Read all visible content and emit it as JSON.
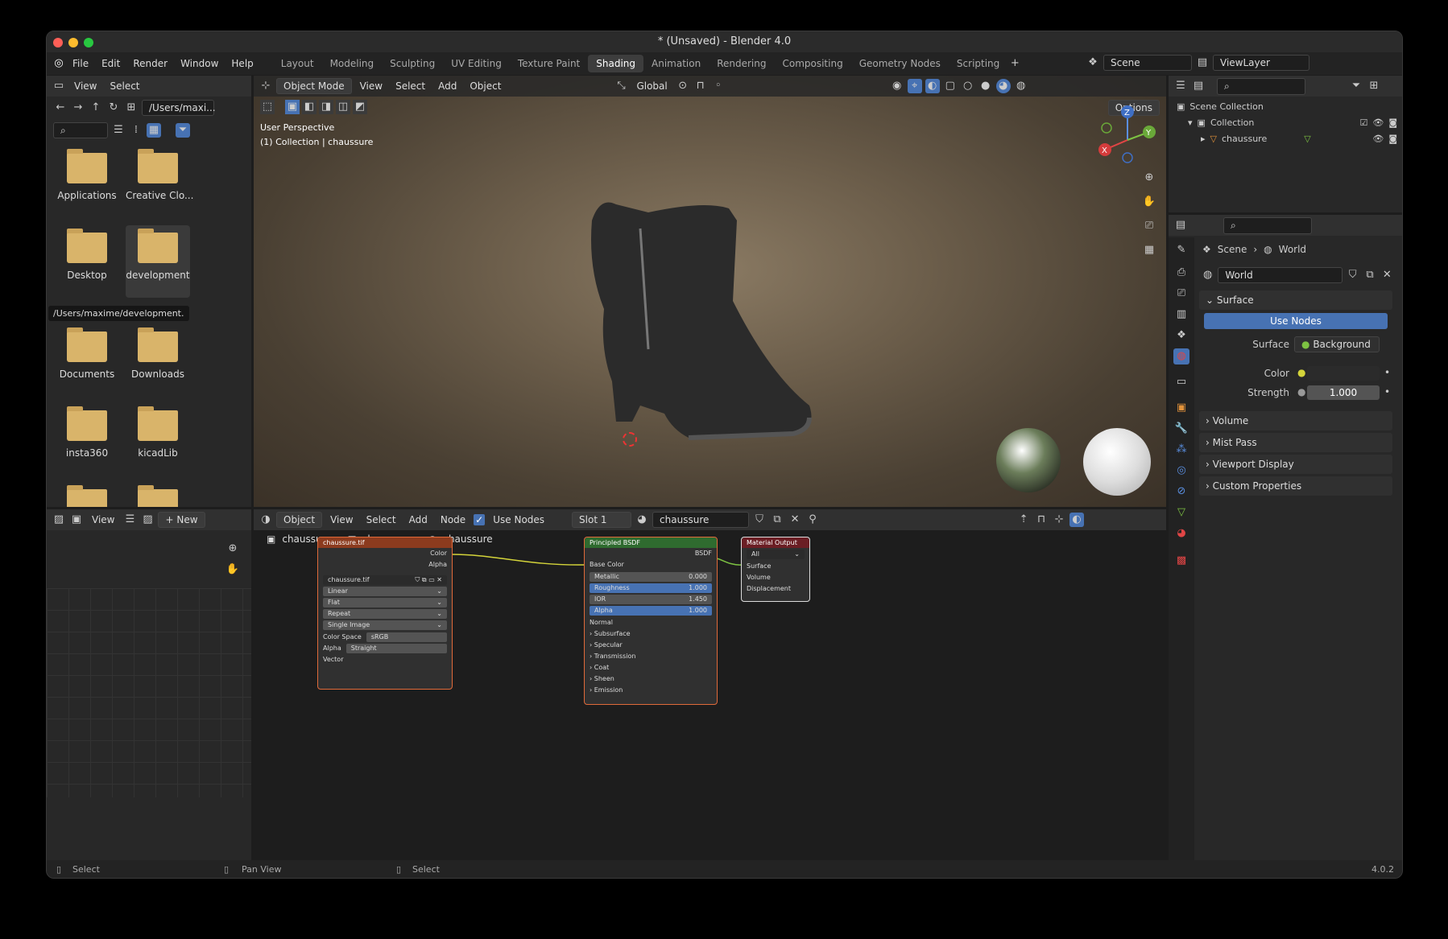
{
  "window": {
    "title": "* (Unsaved) - Blender 4.0"
  },
  "menu": {
    "items": [
      "File",
      "Edit",
      "Render",
      "Window",
      "Help"
    ]
  },
  "workspaces": [
    "Layout",
    "Modeling",
    "Sculpting",
    "UV Editing",
    "Texture Paint",
    "Shading",
    "Animation",
    "Rendering",
    "Compositing",
    "Geometry Nodes",
    "Scripting"
  ],
  "active_workspace": "Shading",
  "scene": {
    "name": "Scene",
    "viewlayer": "ViewLayer"
  },
  "filebrowser": {
    "view": "View",
    "select": "Select",
    "path": "/Users/maxi...",
    "tooltip": "/Users/maxime/development.",
    "folders": [
      "Applications",
      "Creative Clo...",
      "Desktop",
      "development",
      "Documents",
      "Downloads",
      "insta360",
      "kicadLib",
      "",
      ""
    ]
  },
  "viewport": {
    "mode": "Object Mode",
    "menus": [
      "View",
      "Select",
      "Add",
      "Object"
    ],
    "orientation": "Global",
    "options": "Options",
    "perspective": "User Perspective",
    "collection": "(1) Collection | chaussure"
  },
  "outliner": {
    "scene_collection": "Scene Collection",
    "collection": "Collection",
    "object": "chaussure"
  },
  "properties": {
    "breadcrumb_scene": "Scene",
    "breadcrumb_world": "World",
    "world_name": "World",
    "surface_section": "Surface",
    "use_nodes": "Use Nodes",
    "surface_label": "Surface",
    "surface_value": "Background",
    "color_label": "Color",
    "strength_label": "Strength",
    "strength_value": "1.000",
    "sections": [
      "Volume",
      "Mist Pass",
      "Viewport Display",
      "Custom Properties"
    ]
  },
  "image_editor": {
    "view": "View",
    "new": "New"
  },
  "node_editor": {
    "object_dd": "Object",
    "menus": [
      "View",
      "Select",
      "Add",
      "Node"
    ],
    "use_nodes": "Use Nodes",
    "slot": "Slot 1",
    "material": "chaussure",
    "breadcrumb": [
      "chaussure",
      "chaussure",
      "chaussure"
    ],
    "image_node": {
      "title": "chaussure.tif",
      "out_color": "Color",
      "out_alpha": "Alpha",
      "file": "chaussure.tif",
      "interp": "Linear",
      "proj": "Flat",
      "ext": "Repeat",
      "src": "Single Image",
      "cs_label": "Color Space",
      "cs_value": "sRGB",
      "alpha_label": "Alpha",
      "alpha_value": "Straight",
      "vector": "Vector"
    },
    "bsdf": {
      "title": "Principled BSDF",
      "out": "BSDF",
      "base_color": "Base Color",
      "metallic": "Metallic",
      "metallic_v": "0.000",
      "roughness": "Roughness",
      "roughness_v": "1.000",
      "ior": "IOR",
      "ior_v": "1.450",
      "alpha": "Alpha",
      "alpha_v": "1.000",
      "normal": "Normal",
      "subs": [
        "Subsurface",
        "Specular",
        "Transmission",
        "Coat",
        "Sheen",
        "Emission"
      ]
    },
    "output": {
      "title": "Material Output",
      "target": "All",
      "surface": "Surface",
      "volume": "Volume",
      "displacement": "Displacement"
    }
  },
  "status": {
    "left": "Select",
    "mid": "Pan View",
    "right": "Select",
    "version": "4.0.2"
  },
  "colors": {
    "accent": "#4772b3",
    "folder": "#d9b46a",
    "image_node": "#e06a3a",
    "bsdf_node": "#3a8a3a",
    "output_node": "#c0392b"
  }
}
